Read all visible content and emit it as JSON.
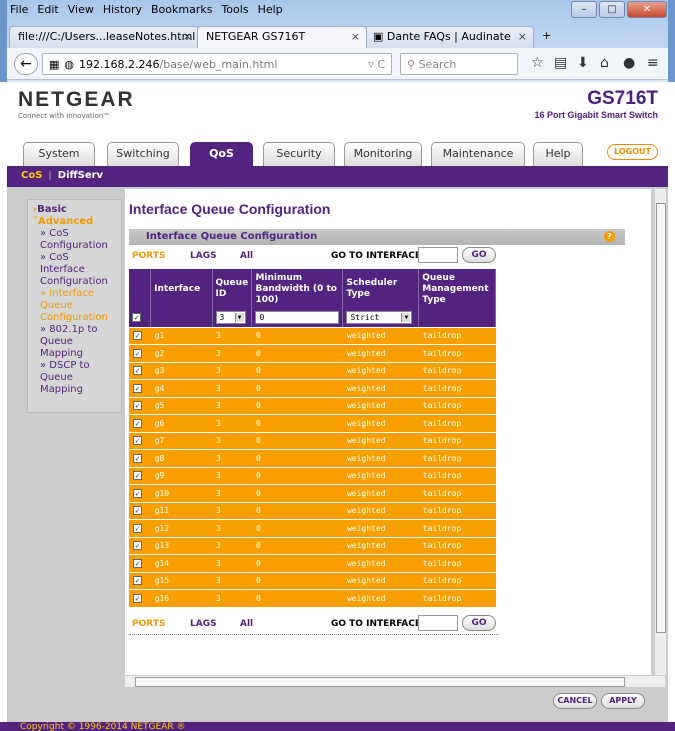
{
  "browser": {
    "menu": [
      "File",
      "Edit",
      "View",
      "History",
      "Bookmarks",
      "Tools",
      "Help"
    ],
    "tabs": [
      {
        "label": "file:///C:/Users...leaseNotes.html"
      },
      {
        "label": "NETGEAR GS716T"
      },
      {
        "label": "Dante FAQs | Audinate"
      }
    ],
    "url_host": "192.168.2.246",
    "url_path": "/base/web_main.html",
    "search_placeholder": "Search"
  },
  "header": {
    "brand": "NETGEAR",
    "tagline": "Connect with Innovation™",
    "model": "GS716T",
    "model_desc": "16 Port Gigabit Smart Switch",
    "logout": "LOGOUT"
  },
  "main_tabs": [
    "System",
    "Switching",
    "QoS",
    "Security",
    "Monitoring",
    "Maintenance",
    "Help"
  ],
  "sub_nav": [
    "CoS",
    "DiffServ"
  ],
  "left_nav": {
    "basic": "Basic",
    "advanced": "Advanced",
    "items": [
      "CoS Configuration",
      "CoS Interface Configuration",
      "Interface Queue Configuration",
      "802.1p to Queue Mapping",
      "DSCP to Queue Mapping"
    ]
  },
  "page_title": "Interface Queue Configuration",
  "panel_title": "Interface Queue Configuration",
  "filter": {
    "ports": "PORTS",
    "lags": "LAGS",
    "all": "All",
    "goto": "GO TO INTERFACE",
    "go": "GO"
  },
  "table": {
    "headers": [
      "Interface",
      "Queue ID",
      "Minimum Bandwidth (0 to 100)",
      "Scheduler Type",
      "Queue Management Type"
    ],
    "edit_row": {
      "queue_id": "3",
      "bandwidth": "0",
      "scheduler": "Strict"
    },
    "rows": [
      [
        "g1",
        "3",
        "0",
        "weighted",
        "taildrop"
      ],
      [
        "g2",
        "3",
        "0",
        "weighted",
        "taildrop"
      ],
      [
        "g3",
        "3",
        "0",
        "weighted",
        "taildrop"
      ],
      [
        "g4",
        "3",
        "0",
        "weighted",
        "taildrop"
      ],
      [
        "g5",
        "3",
        "0",
        "weighted",
        "taildrop"
      ],
      [
        "g6",
        "3",
        "0",
        "weighted",
        "taildrop"
      ],
      [
        "g7",
        "3",
        "0",
        "weighted",
        "taildrop"
      ],
      [
        "g8",
        "3",
        "0",
        "weighted",
        "taildrop"
      ],
      [
        "g9",
        "3",
        "0",
        "weighted",
        "taildrop"
      ],
      [
        "g10",
        "3",
        "0",
        "weighted",
        "taildrop"
      ],
      [
        "g11",
        "3",
        "0",
        "weighted",
        "taildrop"
      ],
      [
        "g12",
        "3",
        "0",
        "weighted",
        "taildrop"
      ],
      [
        "g13",
        "3",
        "0",
        "weighted",
        "taildrop"
      ],
      [
        "g14",
        "3",
        "0",
        "weighted",
        "taildrop"
      ],
      [
        "g15",
        "3",
        "0",
        "weighted",
        "taildrop"
      ],
      [
        "g16",
        "3",
        "0",
        "weighted",
        "taildrop"
      ]
    ]
  },
  "buttons": {
    "cancel": "CANCEL",
    "apply": "APPLY"
  },
  "footer": "Copyright © 1996-2014 NETGEAR ®",
  "colors": {
    "purple": "#52237f",
    "orange": "#f9a000"
  }
}
